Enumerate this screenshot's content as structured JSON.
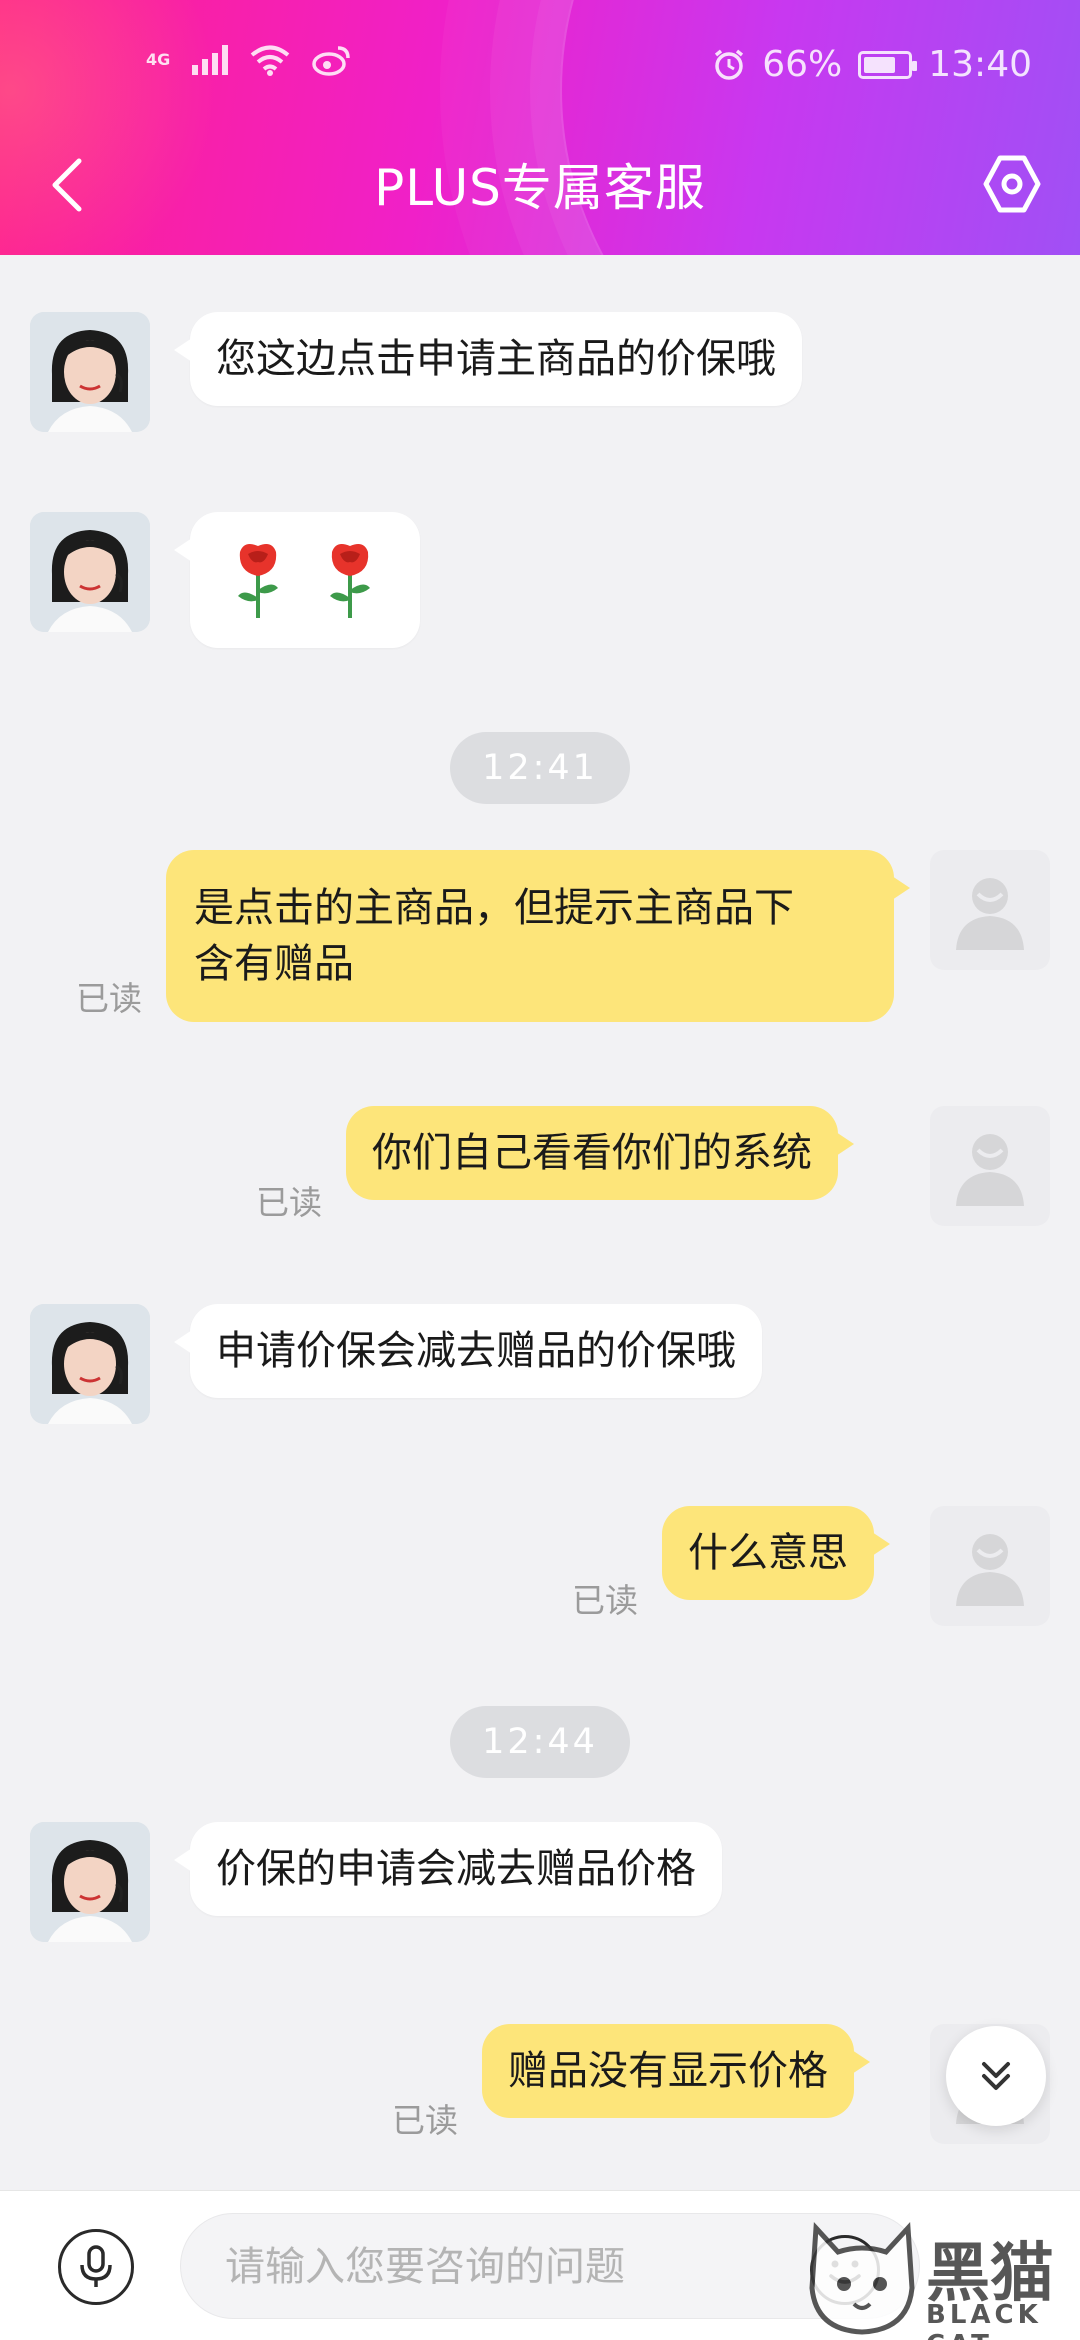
{
  "status_bar": {
    "network_label": "4G",
    "battery_percent": "66%",
    "time": "13:40",
    "battery_level": 0.66
  },
  "header": {
    "title": "PLUS专属客服"
  },
  "messages": [
    {
      "side": "agent",
      "text": "您这边点击申请主商品的价保哦"
    },
    {
      "side": "agent",
      "text": "🌹 🌹"
    },
    {
      "side": "time",
      "text": "12:41"
    },
    {
      "side": "user",
      "lines": [
        "是点击的主商品，但提示主商品下",
        "含有赠品"
      ],
      "read": "已读"
    },
    {
      "side": "user",
      "text": "你们自己看看你们的系统",
      "read": "已读"
    },
    {
      "side": "agent",
      "text": "申请价保会减去赠品的价保哦"
    },
    {
      "side": "user",
      "text": "什么意思",
      "read": "已读"
    },
    {
      "side": "time",
      "text": "12:44"
    },
    {
      "side": "agent",
      "text": "价保的申请会减去赠品价格"
    },
    {
      "side": "user",
      "text": "赠品没有显示价格",
      "read": "已读"
    }
  ],
  "input": {
    "placeholder": "请输入您要咨询的问题"
  },
  "watermark": {
    "text": "黑猫",
    "sub": "BLACK CAT"
  },
  "colors": {
    "user_bubble": "#fde57a",
    "agent_bubble": "#ffffff",
    "background": "#f2f2f4",
    "header_gradient_start": "#ff1f8e",
    "header_gradient_end": "#a050f5"
  }
}
